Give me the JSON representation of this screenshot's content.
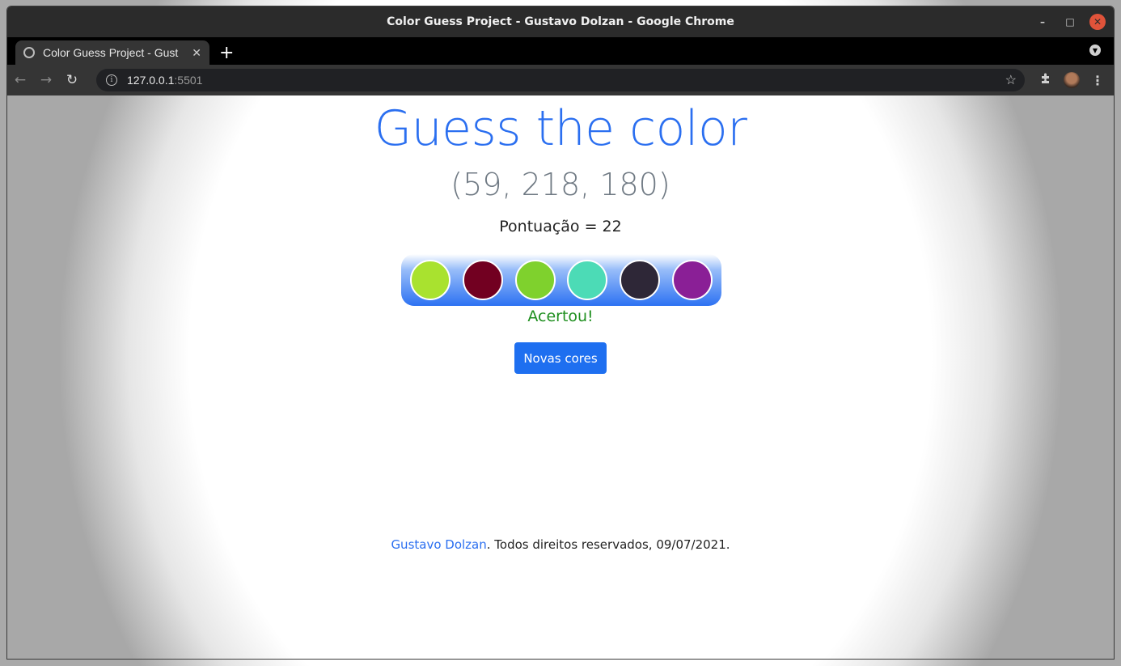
{
  "window": {
    "title": "Color Guess Project - Gustavo Dolzan - Google Chrome",
    "controls": {
      "minimize": "–",
      "maximize": "□",
      "close": "✕"
    }
  },
  "browser": {
    "tab": {
      "title": "Color Guess Project - Gust",
      "close": "✕",
      "icon": "globe-icon"
    },
    "new_tab": "+",
    "address": {
      "host": "127.0.0.1",
      "port": ":5501",
      "info": "i"
    },
    "nav": {
      "back": "←",
      "forward": "→",
      "reload": "↻"
    },
    "icons": {
      "star": "☆",
      "extensions": "⬛",
      "menu": "⋮",
      "tab_menu": "▼"
    }
  },
  "page": {
    "heading": "Guess the color",
    "rgb_target": "(59, 218, 180)",
    "score_text": "Pontuação = 22",
    "swatches": [
      "#a9e22f",
      "#720021",
      "#7fd12d",
      "#4cdbb6",
      "#2e2737",
      "#8a1f96"
    ],
    "result_text": "Acertou!",
    "result_color": "#1f8f1f",
    "new_colors_button": "Novas cores",
    "footer": {
      "author": "Gustavo Dolzan",
      "text": ". Todos direitos reservados, 09/07/2021."
    }
  },
  "colors": {
    "accent": "#2b6ff0",
    "button": "#1e6ff0"
  }
}
